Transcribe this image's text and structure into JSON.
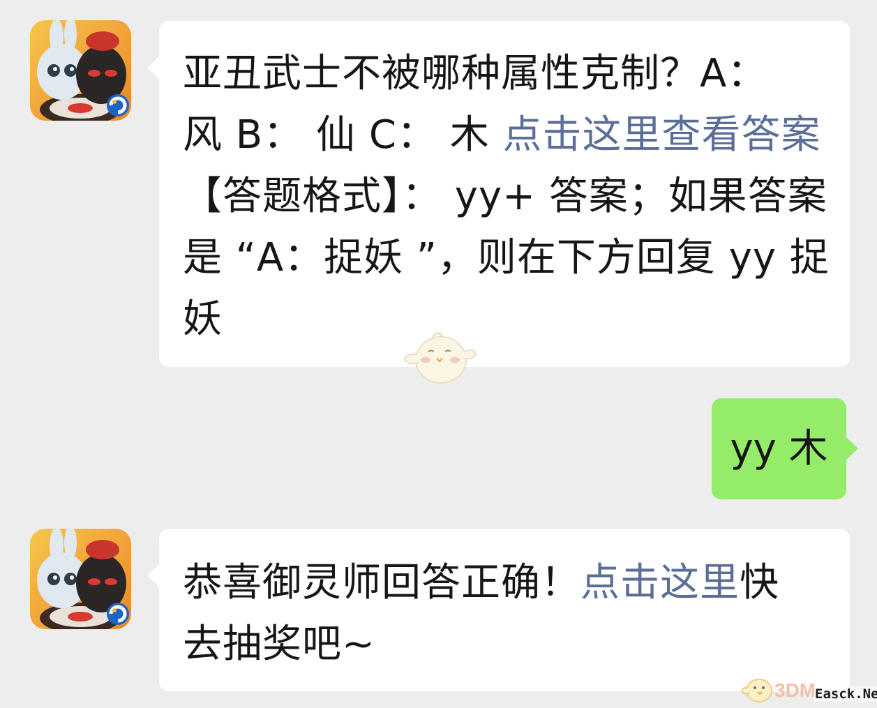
{
  "messages": [
    {
      "lines": [
        [
          {
            "text": "亚丑武士不被哪种属性克制？A：",
            "link": false
          }
        ],
        [
          {
            "text": "风 B：  仙 C：  木  ",
            "link": false
          },
          {
            "text": "点击这里查看答案",
            "link": true
          }
        ],
        [
          {
            "text": "【答题格式】：  yy+ 答案；如果答案",
            "link": false
          }
        ],
        [
          {
            "text": "是 “A：捉妖 ”，则在下方回复 yy 捉",
            "link": false
          }
        ],
        [
          {
            "text": "妖",
            "link": false
          }
        ]
      ]
    },
    {
      "text": "yy 木"
    },
    {
      "lines": [
        [
          {
            "text": "恭喜御灵师回答正确！",
            "link": false
          },
          {
            "text": "点击这里",
            "link": true
          },
          {
            "text": "快",
            "link": false
          }
        ],
        [
          {
            "text": "去抽奖吧~",
            "link": false
          }
        ]
      ]
    }
  ],
  "watermark": {
    "brand": "3DM",
    "site": "Easck.Net"
  },
  "colors": {
    "background": "#ededed",
    "bubble_in": "#ffffff",
    "bubble_out": "#95ec69",
    "link": "#5a6e98"
  }
}
